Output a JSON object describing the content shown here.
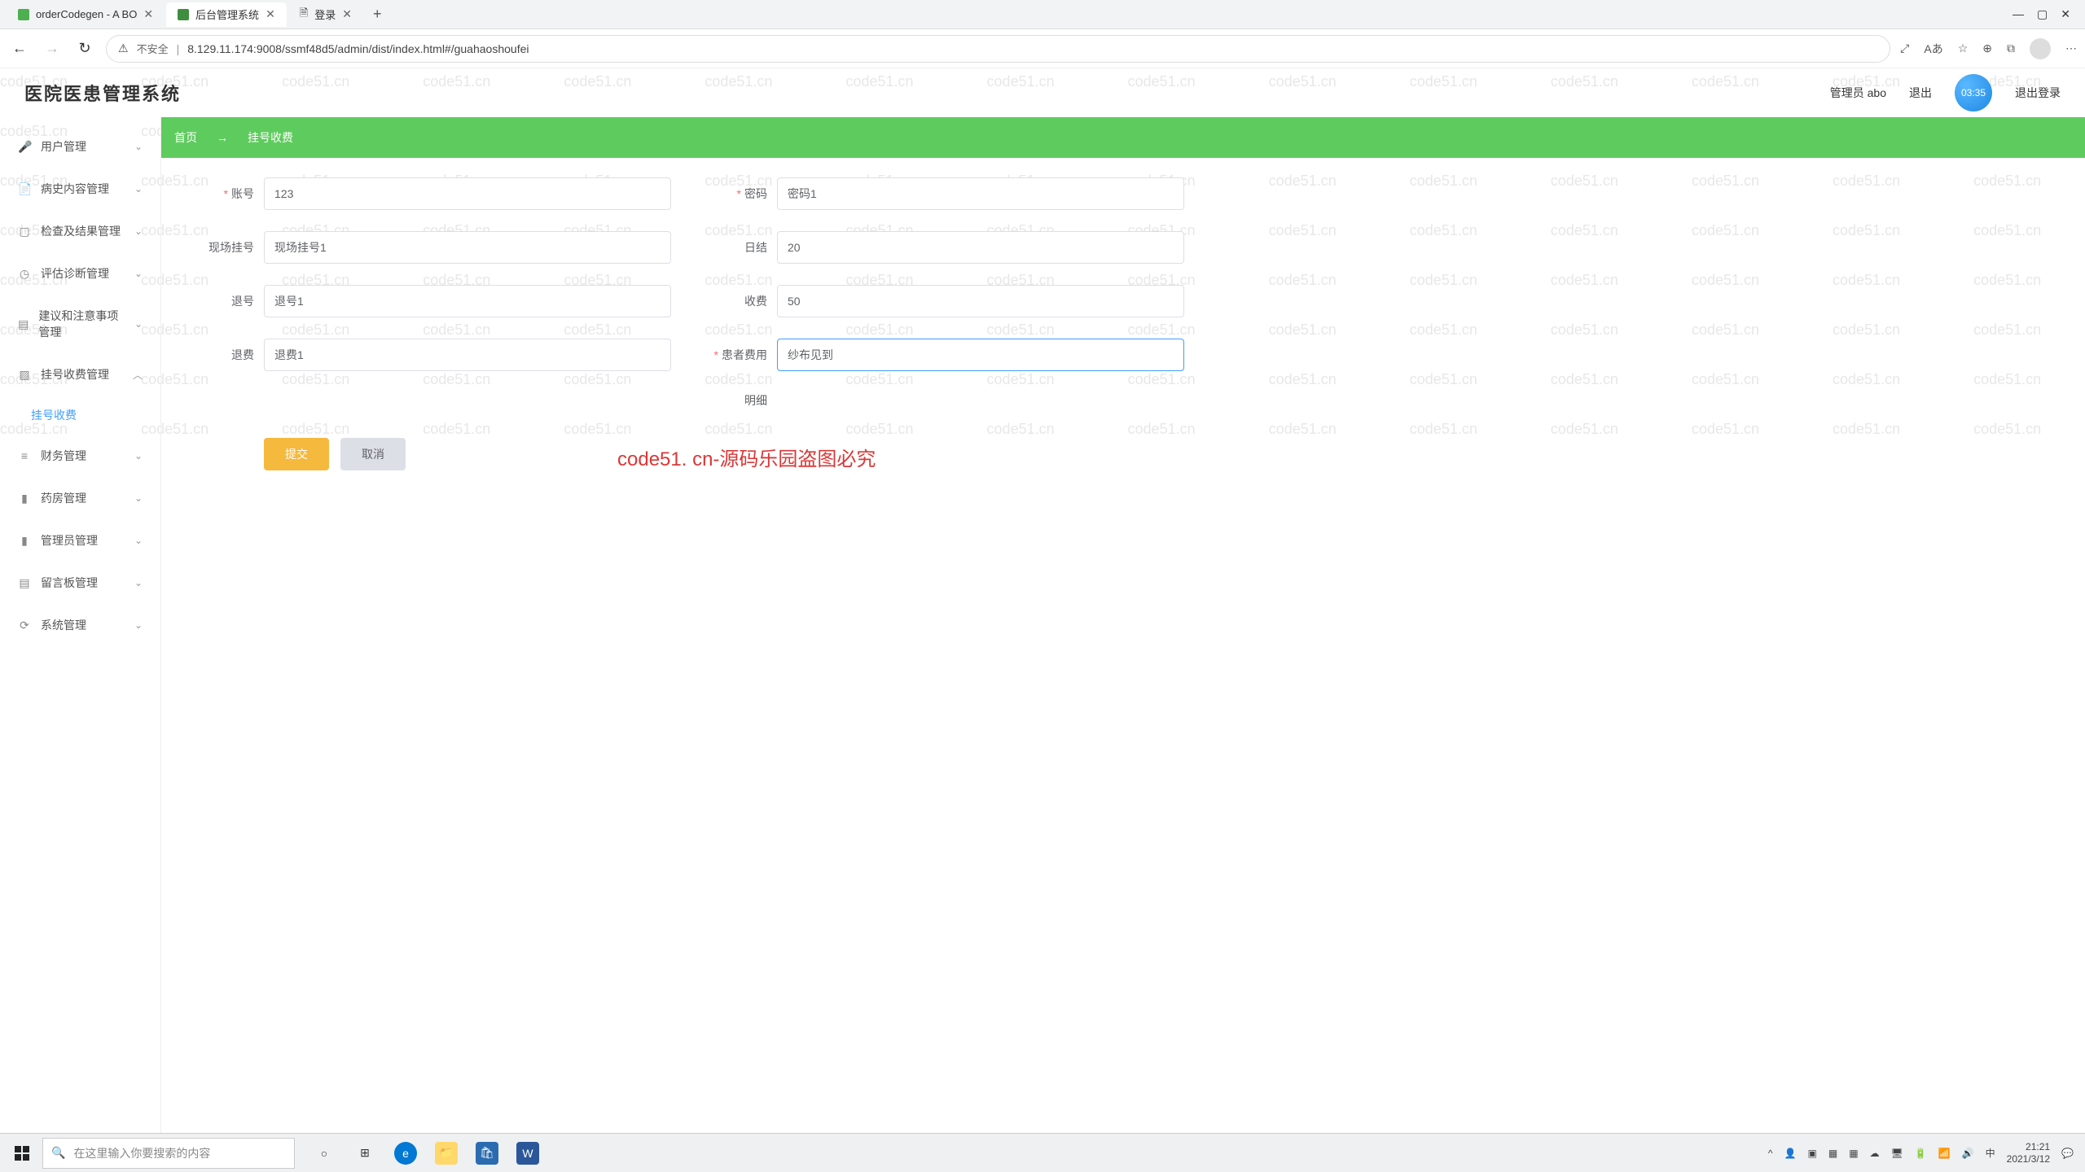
{
  "browser": {
    "tabs": [
      {
        "title": "orderCodegen - A BO"
      },
      {
        "title": "后台管理系统",
        "active": true
      },
      {
        "title": "登录"
      }
    ],
    "window_controls": {
      "min": "—",
      "max": "▢",
      "close": "✕"
    },
    "nav": {
      "back": "←",
      "forward": "→",
      "reload": "↻"
    },
    "security_label": "不安全",
    "url": "8.129.11.174:9008/ssmf48d5/admin/dist/index.html#/guahaoshoufei",
    "right_icons": [
      "⤢",
      "Aあ",
      "☆",
      "⊕",
      "⧉",
      "◯",
      "⋯"
    ]
  },
  "app": {
    "title": "医院医患管理系统",
    "header_admin": "管理员 abo",
    "header_logout_partial": "退出",
    "header_logout": "退出登录",
    "timer": "03:35",
    "sidebar": [
      {
        "icon": "🎤",
        "label": "用户管理"
      },
      {
        "icon": "📄",
        "label": "病史内容管理"
      },
      {
        "icon": "▢",
        "label": "检查及结果管理"
      },
      {
        "icon": "◷",
        "label": "评估诊断管理"
      },
      {
        "icon": "▤",
        "label": "建议和注意事项管理"
      },
      {
        "icon": "▨",
        "label": "挂号收费管理",
        "expanded": true,
        "children": [
          {
            "label": "挂号收费"
          }
        ]
      },
      {
        "icon": "≡",
        "label": "财务管理"
      },
      {
        "icon": "▮",
        "label": "药房管理"
      },
      {
        "icon": "▮",
        "label": "管理员管理"
      },
      {
        "icon": "▤",
        "label": "留言板管理"
      },
      {
        "icon": "⟳",
        "label": "系统管理"
      }
    ],
    "tabs_strip": {
      "home": "首页",
      "sep": "→",
      "current": "挂号收费"
    },
    "form": {
      "account": {
        "label": "账号",
        "required": true,
        "value": "123"
      },
      "password": {
        "label": "密码",
        "required": true,
        "value": "密码1"
      },
      "onsite": {
        "label": "现场挂号",
        "value": "现场挂号1"
      },
      "daily": {
        "label": "日结",
        "value": "20"
      },
      "refund_num": {
        "label": "退号",
        "value": "退号1"
      },
      "fee": {
        "label": "收费",
        "value": "50"
      },
      "refund_fee": {
        "label": "退费",
        "value": "退费1"
      },
      "patient_fee": {
        "label": "患者费用",
        "required": true,
        "value": "纱布见到"
      },
      "detail_label": "明细"
    },
    "buttons": {
      "submit": "提交",
      "cancel": "取消"
    },
    "watermark": "code51. cn-源码乐园盗图必究"
  },
  "taskbar": {
    "search_placeholder": "在这里输入你要搜索的内容",
    "time": "21:21",
    "date": "2021/3/12"
  },
  "bg_watermark_text": "code51.cn"
}
